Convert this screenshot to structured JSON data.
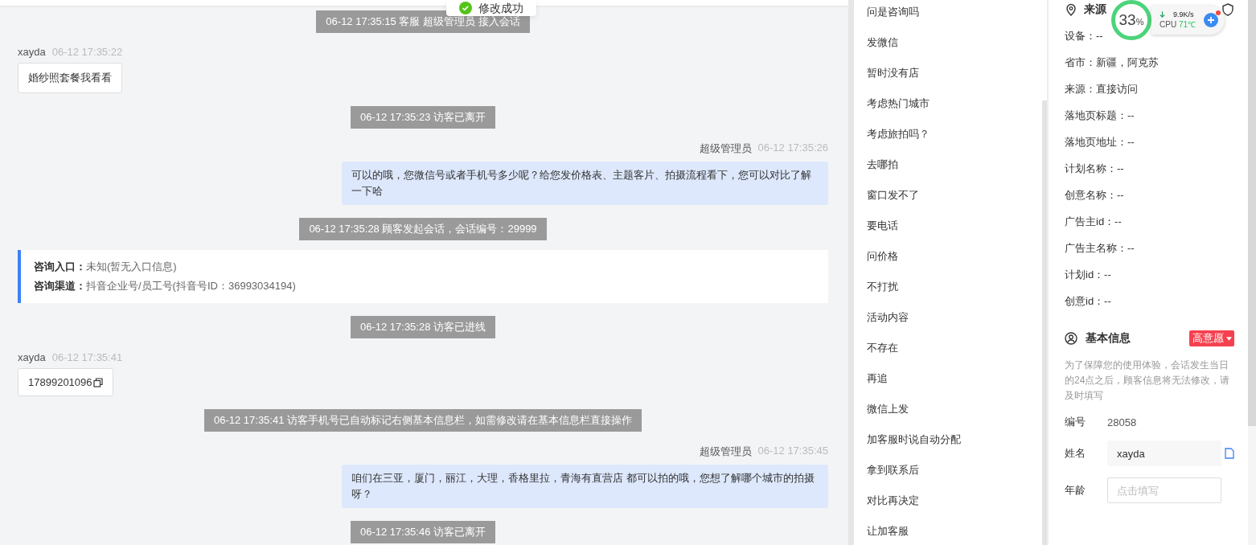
{
  "toast": {
    "text": "修改成功"
  },
  "chat": {
    "messages": [
      {
        "kind": "system",
        "text": "06-12 17:35:15 客服 超级管理员 接入会话"
      },
      {
        "kind": "visitor",
        "name": "xayda",
        "time": "06-12 17:35:22",
        "text": "婚纱照套餐我看看",
        "copy": false
      },
      {
        "kind": "system",
        "text": "06-12 17:35:23 访客已离开"
      },
      {
        "kind": "agent",
        "name": "超级管理员",
        "time": "06-12 17:35:26",
        "text": "可以的哦，您微信号或者手机号多少呢？给您发价格表、主题客片、拍摄流程看下，您可以对比了解一下哈"
      },
      {
        "kind": "system",
        "text": "06-12 17:35:28 顾客发起会话，会话编号：29999"
      },
      {
        "kind": "info",
        "lines": [
          {
            "label": "咨询入口：",
            "value": "未知(暂无入口信息)"
          },
          {
            "label": "咨询渠道：",
            "value": "抖音企业号/员工号(抖音号ID：36993034194)"
          }
        ]
      },
      {
        "kind": "system",
        "text": "06-12 17:35:28 访客已进线"
      },
      {
        "kind": "visitor",
        "name": "xayda",
        "time": "06-12 17:35:41",
        "text": "17899201096",
        "copy": true
      },
      {
        "kind": "system",
        "text": "06-12 17:35:41 访客手机号已自动标记右侧基本信息栏，如需修改请在基本信息栏直接操作"
      },
      {
        "kind": "agent",
        "name": "超级管理员",
        "time": "06-12 17:35:45",
        "text": "咱们在三亚，厦门，丽江，大理，香格里拉，青海有直营店 都可以拍的哦，您想了解哪个城市的拍摄呀？"
      },
      {
        "kind": "system",
        "text": "06-12 17:35:46 访客已离开"
      }
    ]
  },
  "quick_replies": [
    "问是咨询吗",
    "发微信",
    "暂时没有店",
    "考虑热门城市",
    "考虑旅拍吗？",
    "去哪拍",
    "窗口发不了",
    "要电话",
    "问价格",
    "不打扰",
    "活动内容",
    "不存在",
    "再追",
    "微信上发",
    "加客服时说自动分配",
    "拿到联系后",
    "对比再决定",
    "让加客服"
  ],
  "source_info": {
    "title": "来源",
    "fields": [
      "设备：--",
      "省市：新疆，阿克苏",
      "来源：直接访问",
      "落地页标题：--",
      "落地页地址：--",
      "计划名称：--",
      "创意名称：--",
      "广告主id：--",
      "广告主名称：--",
      "计划id：--",
      "创意id：--"
    ]
  },
  "basic_info": {
    "title": "基本信息",
    "tag": "高意愿",
    "notice": "为了保障您的使用体验，会话发生当日的24点之后，顾客信息将无法修改，请及时填写",
    "fields": [
      {
        "kind": "text",
        "label": "编号",
        "value": "28058"
      },
      {
        "kind": "input",
        "label": "姓名",
        "value": "xayda"
      },
      {
        "kind": "input",
        "label": "年龄",
        "placeholder": "点击填写"
      }
    ]
  },
  "monitor": {
    "percent": "33",
    "unit": "%",
    "speed": "9.9K/s",
    "cpu_label": "CPU",
    "temperature": "71℃"
  }
}
